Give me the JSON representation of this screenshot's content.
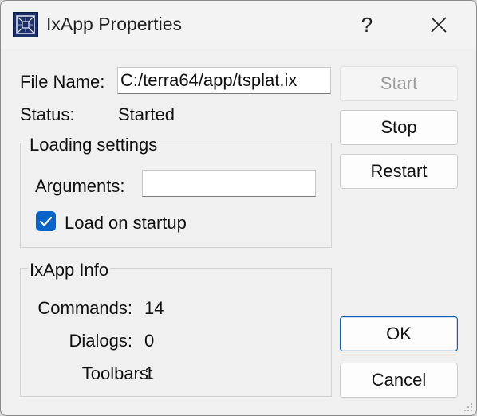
{
  "window": {
    "title": "IxApp Properties",
    "help_label": "?"
  },
  "file": {
    "label": "File Name:",
    "value": "C:/terra64/app/tsplat.ix"
  },
  "status": {
    "label": "Status:",
    "value": "Started"
  },
  "loading": {
    "group_title": "Loading settings",
    "arguments_label": "Arguments:",
    "arguments_value": "",
    "load_on_startup_label": "Load on startup",
    "load_on_startup_checked": true
  },
  "info": {
    "group_title": "IxApp Info",
    "commands_label": "Commands:",
    "commands_value": "14",
    "dialogs_label": "Dialogs:",
    "dialogs_value": "0",
    "toolbars_label": "Toolbars:",
    "toolbars_value": "1"
  },
  "buttons": {
    "start": "Start",
    "stop": "Stop",
    "restart": "Restart",
    "ok": "OK",
    "cancel": "Cancel"
  },
  "colors": {
    "accent": "#0a64c8",
    "window_bg": "#f0f0f0"
  }
}
